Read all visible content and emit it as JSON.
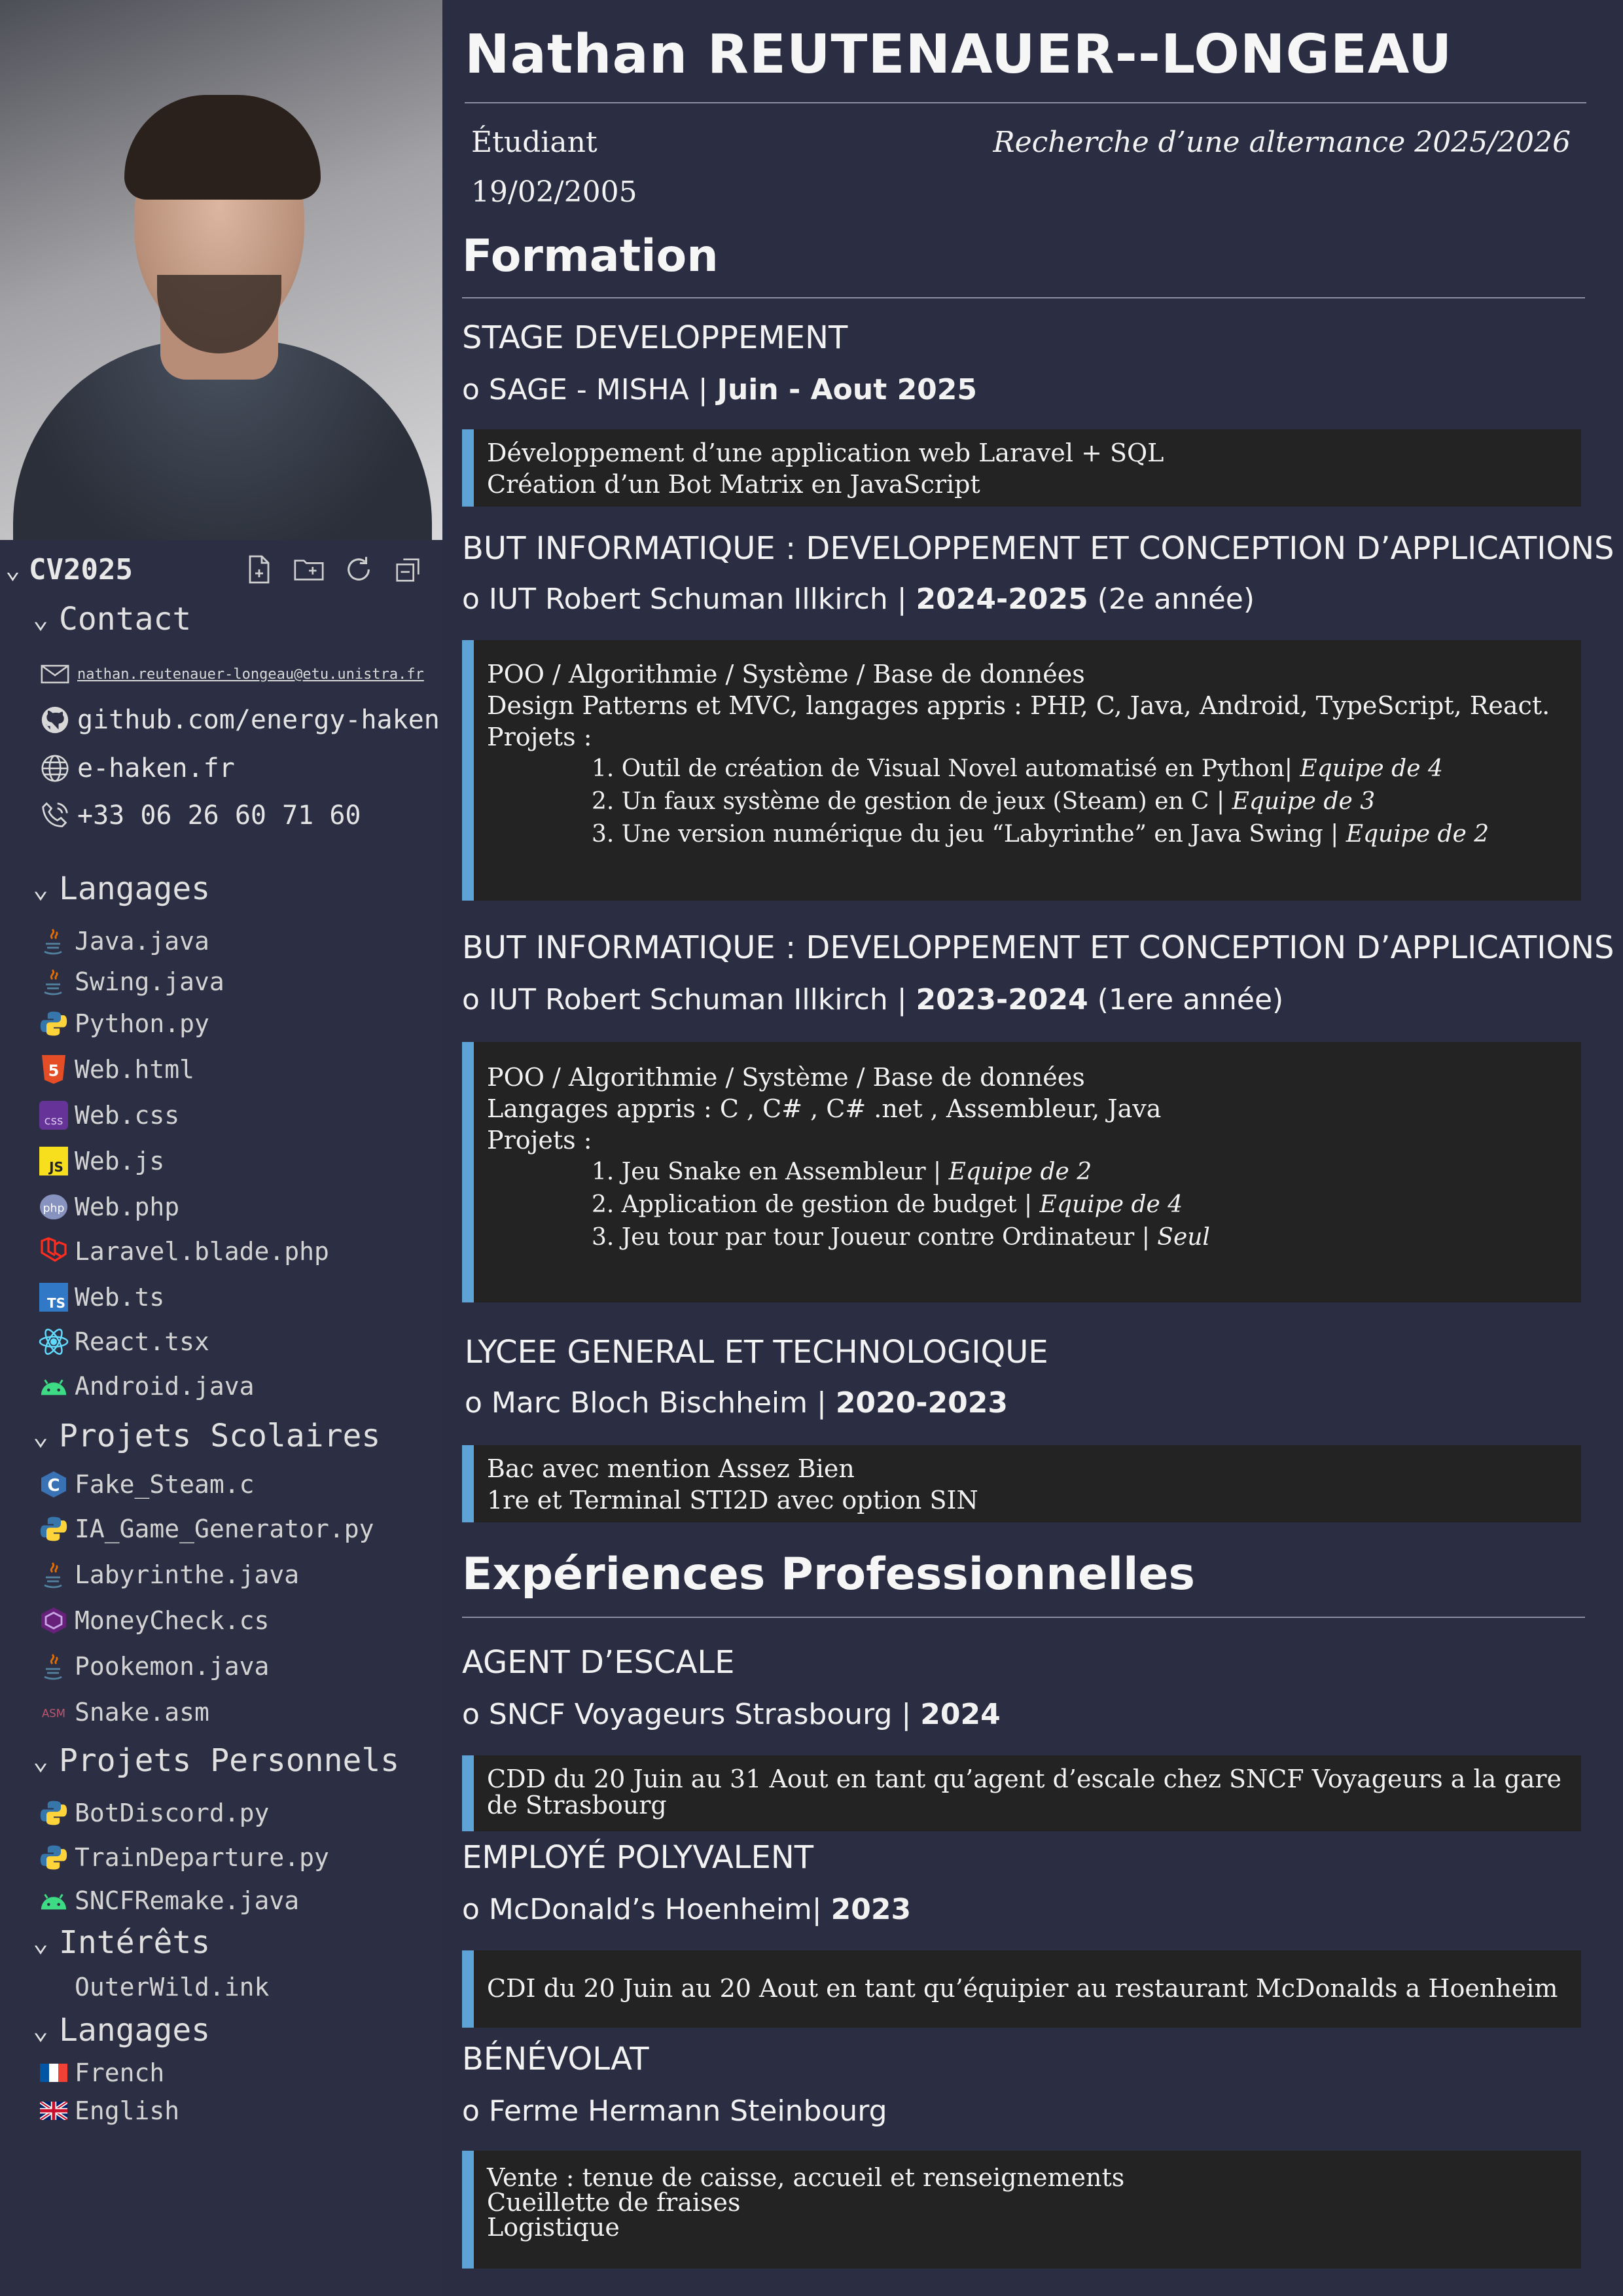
{
  "sidebar": {
    "tree_title": "CV2025",
    "actions": [
      "new-file-icon",
      "new-folder-icon",
      "refresh-icon",
      "collapse-all-icon"
    ],
    "contact": {
      "title": "Contact",
      "email": "nathan.reutenauer-longeau@etu.unistra.fr",
      "github": "github.com/energy-haken",
      "website": "e-haken.fr",
      "phone": "+33 06 26 60 71 60"
    },
    "langages": {
      "title": "Langages",
      "items": [
        "Java.java",
        "Swing.java",
        "Python.py",
        "Web.html",
        "Web.css",
        "Web.js",
        "Web.php",
        "Laravel.blade.php",
        "Web.ts",
        "React.tsx",
        "Android.java"
      ]
    },
    "projets_scolaires": {
      "title": "Projets Scolaires",
      "items": [
        "Fake_Steam.c",
        "IA_Game_Generator.py",
        "Labyrinthe.java",
        "MoneyCheck.cs",
        "Pookemon.java",
        "Snake.asm"
      ]
    },
    "projets_personnels": {
      "title": "Projets Personnels",
      "items": [
        "BotDiscord.py",
        "TrainDeparture.py",
        "SNCFRemake.java"
      ]
    },
    "interets": {
      "title": "Intérêts",
      "items": [
        "OuterWild.ink"
      ]
    },
    "langues": {
      "title": "Langages",
      "items": [
        "French",
        "English"
      ]
    }
  },
  "header": {
    "name": "Nathan REUTENAUER--LONGEAU",
    "status": "Étudiant",
    "birthdate": "19/02/2005",
    "search": "Recherche d’une alternance 2025/2026"
  },
  "formation": {
    "title": "Formation",
    "entries": [
      {
        "title": "STAGE DEVELOPPEMENT",
        "place": "SAGE - MISHA |",
        "period": "Juin - Aout 2025",
        "extra": "",
        "lines": [
          "Développement d’une application web Laravel + SQL",
          "Création d’un Bot Matrix en JavaScript"
        ]
      },
      {
        "title": "BUT INFORMATIQUE : DEVELOPPEMENT ET CONCEPTION D’APPLICATIONS",
        "place": "IUT Robert Schuman Illkirch |",
        "period": "2024-2025",
        "extra": "(2e année)",
        "lines": [
          "POO / Algorithmie / Système / Base de données",
          "Design Patterns et MVC, langages appris : PHP, C, Java, Android, TypeScript, React.",
          "Projets :"
        ],
        "projects": [
          {
            "text": "1. Outil de création de Visual Novel automatisé en Python|",
            "team": "Equipe de 4"
          },
          {
            "text": "2. Un faux système de gestion de jeux (Steam) en C |",
            "team": "Equipe de 3"
          },
          {
            "text": "3. Une version numérique du jeu “Labyrinthe” en Java Swing |",
            "team": "Equipe de 2"
          }
        ]
      },
      {
        "title": "BUT INFORMATIQUE : DEVELOPPEMENT ET CONCEPTION D’APPLICATIONS",
        "place": "IUT Robert Schuman Illkirch |",
        "period": "2023-2024",
        "extra": "(1ere année)",
        "lines": [
          "POO / Algorithmie / Système / Base de données",
          "Langages appris : C , C# , C# .net , Assembleur, Java",
          "Projets :"
        ],
        "projects": [
          {
            "text": "1. Jeu Snake en Assembleur |",
            "team": "Equipe de 2"
          },
          {
            "text": "2. Application de gestion de budget |",
            "team": "Equipe de 4"
          },
          {
            "text": "3. Jeu tour par tour Joueur contre Ordinateur |",
            "team": "Seul"
          }
        ]
      },
      {
        "title": "LYCEE GENERAL ET TECHNOLOGIQUE",
        "place": "Marc Bloch Bischheim |",
        "period": "2020-2023",
        "extra": "",
        "lines": [
          "Bac avec mention Assez Bien",
          "1re et Terminal STI2D avec option SIN"
        ]
      }
    ]
  },
  "experiences": {
    "title": "Expériences Professionnelles",
    "entries": [
      {
        "title": "AGENT D’ESCALE",
        "place": "SNCF Voyageurs Strasbourg |",
        "period": "2024",
        "lines": [
          "CDD du 20 Juin au 31 Aout en tant qu’agent d’escale chez SNCF Voyageurs a la gare de Strasbourg"
        ]
      },
      {
        "title": "EMPLOYÉ POLYVALENT",
        "place": "McDonald’s Hoenheim|",
        "period": "2023",
        "lines": [
          "CDI du 20 Juin au 20 Aout en tant qu’équipier au restaurant McDonalds a Hoenheim"
        ]
      },
      {
        "title": "BÉNÉVOLAT",
        "place": "Ferme Hermann Steinbourg",
        "period": "",
        "lines": [
          "Vente : tenue de caisse, accueil et renseignements",
          "Cueillette de fraises",
          "Logistique"
        ]
      }
    ]
  },
  "bullet": "o",
  "colors": {
    "background": "#2b2e42",
    "box": "#232323",
    "accent": "#5ea3d6"
  }
}
